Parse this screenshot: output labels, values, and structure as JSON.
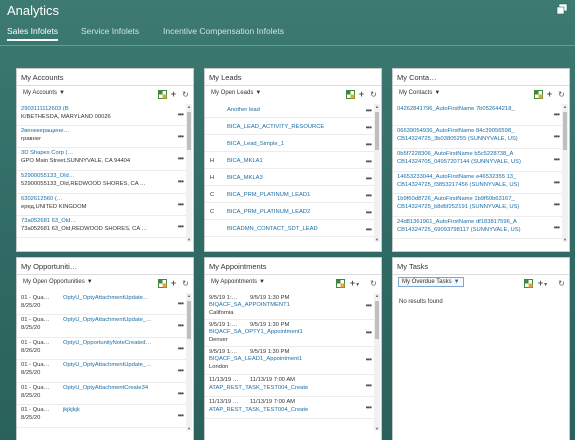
{
  "app": {
    "title": "Analytics"
  },
  "tabs": [
    {
      "label": "Sales Infolets"
    },
    {
      "label": "Service Infolets"
    },
    {
      "label": "Incentive Compensation Infolets"
    }
  ],
  "accounts": {
    "title": "My Accounts",
    "filter": "My Accounts",
    "rows": [
      {
        "line1": "2903111112603 (B",
        "line2": "K/BETHESDA, MARYLAND 00026"
      },
      {
        "line1": "2венекеращене…",
        "line2": "гравнег"
      },
      {
        "line1": "3D Shapes Corp (…",
        "line2": "GPO Main Street,SUNNYVALE, CA 94404"
      },
      {
        "line1": "52900055133_Old…",
        "line2": "52900055133_Old,REDWOOD SHORES, CA …"
      },
      {
        "line1": "6302612560 (…",
        "line2": "еред,UNITED KINGDOM"
      },
      {
        "line1": "73a052681 63_Old…",
        "line2": "73a052681 63_Old,REDWOOD SHORES, CA …"
      }
    ]
  },
  "leads": {
    "title": "My Leads",
    "filter": "My Open Leads",
    "rows": [
      {
        "prefix": "",
        "name": "Another lead"
      },
      {
        "prefix": "",
        "name": "BICA_LEAD_ACTIVITY_RESOURCE"
      },
      {
        "prefix": "",
        "name": "BICA_Lead_Simple_1"
      },
      {
        "prefix": "H",
        "name": "BICA_MKLA1"
      },
      {
        "prefix": "H",
        "name": "BICA_MKLA3"
      },
      {
        "prefix": "C",
        "name": "BICA_PRM_PLATINUM_LEAD1"
      },
      {
        "prefix": "C",
        "name": "BICA_PRM_PLATINUM_LEAD2"
      },
      {
        "prefix": "",
        "name": "BICADMN_CONTACT_SDT_LEAD"
      }
    ]
  },
  "contacts": {
    "title": "My Conta…",
    "filter": "My Contacts",
    "rows": [
      {
        "line1": "04262841796_AutoFirstName 7b052644218_",
        "line2": ""
      },
      {
        "line1": "06639054936_AutoFirstName 84c39056598_",
        "line2": "CB14324725_3b03805255 (SUNNYVALE, US)"
      },
      {
        "line1": "0b5f7228306_AutoFirstName b5c5228738_A",
        "line2": "CB14324705_04957207144 (SUNNYVALE, US)"
      },
      {
        "line1": "14653233044_AutoFirstName e46532355 13_",
        "line2": "CB14324725_f3853217456 (SUNNYVALE, US)"
      },
      {
        "line1": "1b9f60d8726_AutoFirstName 1b9f60b63167_",
        "line2": "CB14324725_b8d6f252191 (SUNNYVALE, US)"
      },
      {
        "line1": "24d81361961_AutoFirstName df183817596_A",
        "line2": "CB14324725_69093798117 (SUNNYVALE, US)"
      }
    ]
  },
  "opportunities": {
    "title": "My Opportuniti…",
    "filter": "My Open Opportunities",
    "rows": [
      {
        "stage": "01 - Qua…",
        "date": "8/25/20",
        "name": "OptyU_OptyAttachmentUpdate…"
      },
      {
        "stage": "01 - Qua…",
        "date": "8/25/20",
        "name": "OptyU_OptyAttachmentUpdate_…"
      },
      {
        "stage": "01 - Qua…",
        "date": "8/26/20",
        "name": "OptyU_OpportunityNoteCreated…"
      },
      {
        "stage": "01 - Qua…",
        "date": "8/25/20",
        "name": "OptyU_OptyAttachmentUpdate_…"
      },
      {
        "stage": "01 - Qua…",
        "date": "8/25/20",
        "name": "OptyU_OptyAttachmentCreate34"
      },
      {
        "stage": "01 - Qua…",
        "date": "8/25/20",
        "name": "jkjkjkjk"
      }
    ]
  },
  "appointments": {
    "title": "My Appointments",
    "filter": "My Appointments",
    "rows": [
      {
        "start": "9/5/19 1:…",
        "end": "9/5/19 1:30 PM",
        "name": "BIQACF_SA_APPOINTMENT1",
        "location": "California"
      },
      {
        "start": "9/5/19 1:…",
        "end": "9/5/19 1:30 PM",
        "name": "BIQACF_SA_OPTY1_Appointment1",
        "location": "Denver"
      },
      {
        "start": "9/5/19 1:…",
        "end": "9/5/19 1:30 PM",
        "name": "BIQACF_SA_LEAD1_Appointment1",
        "location": "London"
      },
      {
        "start": "11/13/19 …",
        "end": "11/13/19 7:00 AM",
        "name": "ATAP_REST_TASK_TEST004_Create",
        "location": ""
      },
      {
        "start": "11/13/19 …",
        "end": "11/13/19 7:00 AM",
        "name": "ATAP_REST_TASK_TEST004_Create",
        "location": ""
      }
    ]
  },
  "tasks": {
    "title": "My Tasks",
    "filter": "My Overdue Tasks",
    "empty": "No results found"
  },
  "icons": {
    "excel": "excel-export-icon",
    "add": "add-icon",
    "refresh": "refresh-icon",
    "more": "more-actions-icon",
    "window": "restore-window-icon"
  },
  "colors": {
    "background": "#2f6b64",
    "link": "#1a6ea8",
    "tab_active": "#ffffff"
  }
}
